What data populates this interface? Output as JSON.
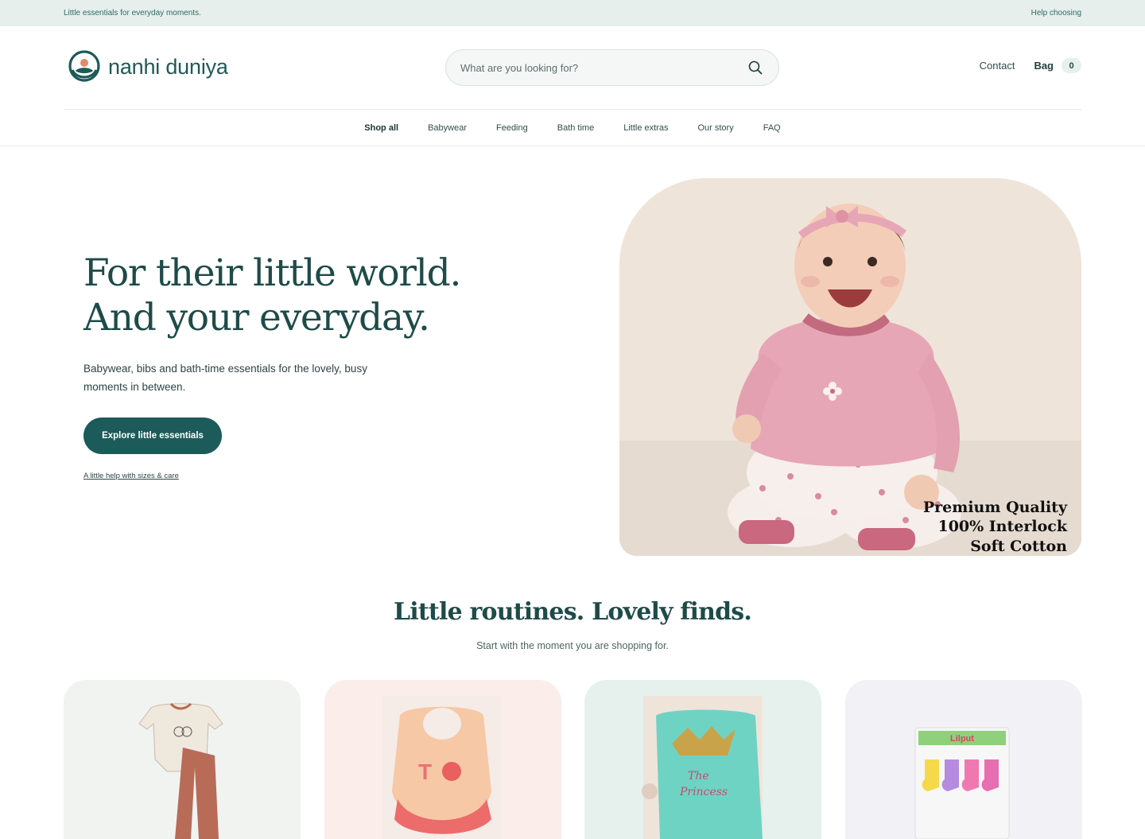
{
  "announcement": {
    "left_text": "Little essentials for everyday moments.",
    "right_link": "Help choosing"
  },
  "header": {
    "brand_name": "nanhi duniya",
    "search_placeholder": "What are you looking for?",
    "contact_label": "Contact",
    "bag_label": "Bag",
    "bag_count": "0"
  },
  "nav": {
    "items": [
      {
        "label": "Shop all",
        "active": true
      },
      {
        "label": "Babywear",
        "active": false
      },
      {
        "label": "Feeding",
        "active": false
      },
      {
        "label": "Bath time",
        "active": false
      },
      {
        "label": "Little extras",
        "active": false
      },
      {
        "label": "Our story",
        "active": false
      },
      {
        "label": "FAQ",
        "active": false
      }
    ]
  },
  "hero": {
    "title_line1": "For their little world.",
    "title_line2": "And your everyday.",
    "subtitle": "Babywear, bibs and bath-time essentials for the lovely, busy moments in between.",
    "cta_label": "Explore little essentials",
    "help_link": "A little help with sizes & care",
    "image_caption_line1": "Premium Quality",
    "image_caption_line2": "100% Interlock",
    "image_caption_line3": "Soft Cotton"
  },
  "section": {
    "title": "Little routines. Lovely finds.",
    "subtitle": "Start with the moment you are shopping for."
  },
  "colors": {
    "brand": "#1c5b59",
    "announce_bg": "#e6efec",
    "card_bg_1": "#f1f3f1",
    "card_bg_2": "#fbeeea",
    "card_bg_3": "#e6f1ee",
    "card_bg_4": "#f1f1f6"
  }
}
